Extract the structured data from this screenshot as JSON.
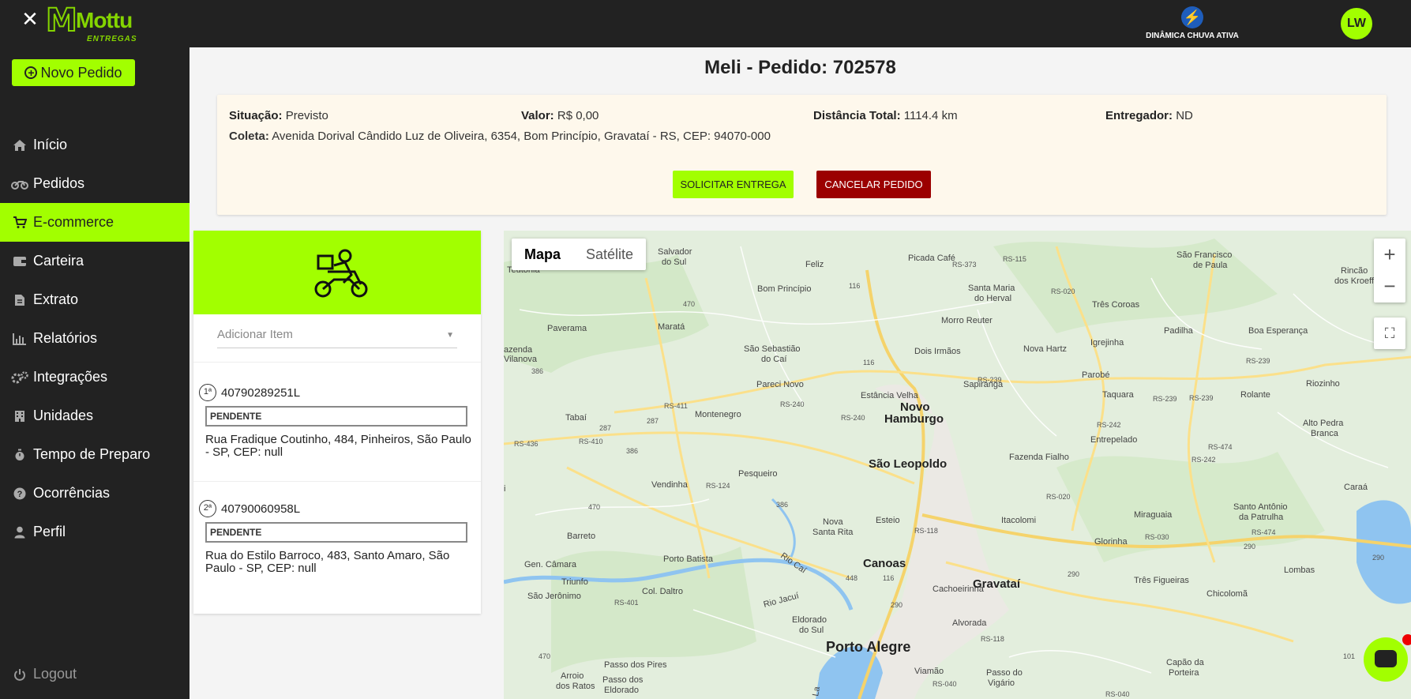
{
  "header": {
    "logo_text": "Mottu",
    "logo_sub": "ENTREGAS",
    "rain_label": "DINÂMICA CHUVA ATIVA",
    "avatar_initials": "LW"
  },
  "sidebar": {
    "new_order_label": "Novo Pedido",
    "items": [
      {
        "label": "Início",
        "icon": "home-icon"
      },
      {
        "label": "Pedidos",
        "icon": "motorcycle-icon"
      },
      {
        "label": "E-commerce",
        "icon": "cart-icon"
      },
      {
        "label": "Carteira",
        "icon": "wallet-icon"
      },
      {
        "label": "Extrato",
        "icon": "document-icon"
      },
      {
        "label": "Relatórios",
        "icon": "bar-chart-icon"
      },
      {
        "label": "Integrações",
        "icon": "gears-icon"
      },
      {
        "label": "Unidades",
        "icon": "building-icon"
      },
      {
        "label": "Tempo de Preparo",
        "icon": "stopwatch-icon"
      },
      {
        "label": "Ocorrências",
        "icon": "question-icon"
      },
      {
        "label": "Perfil",
        "icon": "user-icon"
      }
    ],
    "active_index": 2,
    "logout_label": "Logout"
  },
  "order": {
    "title": "Meli - Pedido: 702578",
    "situacao_label": "Situação:",
    "situacao_value": "Previsto",
    "valor_label": "Valor:",
    "valor_value": "R$ 0,00",
    "distancia_label": "Distância Total:",
    "distancia_value": "1114.4 km",
    "entregador_label": "Entregador:",
    "entregador_value": "ND",
    "coleta_label": "Coleta:",
    "coleta_value": "Avenida Dorival Cândido Luz de Oliveira, 6354, Bom Princípio, Gravataí - RS, CEP: 94070-000",
    "solicitar_label": "SOLICITAR ENTREGA",
    "cancelar_label": "CANCELAR PEDIDO"
  },
  "items_panel": {
    "add_item_placeholder": "Adicionar Item",
    "stops": [
      {
        "num": "1ª",
        "code": "40790289251L",
        "status": "PENDENTE",
        "address": "Rua Fradique Coutinho, 484, Pinheiros, São Paulo - SP, CEP: null"
      },
      {
        "num": "2ª",
        "code": "40790060958L",
        "status": "PENDENTE",
        "address": "Rua do Estilo Barroco, 483, Santo Amaro, São Paulo - SP, CEP: null"
      }
    ]
  },
  "map": {
    "type_map": "Mapa",
    "type_satellite": "Satélite",
    "zoom_in": "+",
    "zoom_out": "−",
    "places": {
      "teutonia": "Teutônia",
      "salvador": "Salvador",
      "do_sul": "do Sul",
      "feliz": "Feliz",
      "picada": "Picada Café",
      "sao_francisco": "São Francisco",
      "de_paula": "de Paula",
      "rincao": "Rincão",
      "dos_kroeff": "dos Kroeff",
      "bom_principio": "Bom Princípio",
      "santa_maria": "Santa Maria",
      "do_herval": "do Herval",
      "tres_coroas": "Três Coroas",
      "paverama": "Paverama",
      "marata": "Maratá",
      "morro_reuter": "Morro Reuter",
      "padilha": "Padilha",
      "boa_esperanca": "Boa Esperança",
      "azenda": "azenda",
      "vilanova": "Vilanova",
      "sao_sebastiao": "São Sebastião",
      "do_cai": "do Caí",
      "dois_irmaos": "Dois Irmãos",
      "nova_hartz": "Nova Hartz",
      "igrejinha": "Igrejinha",
      "pareci": "Pareci Novo",
      "sapiranga": "Sapiranga",
      "parobe": "Parobé",
      "riozinho": "Riozinho",
      "estancia": "Estância Velha",
      "taquara": "Taquara",
      "rolante": "Rolante",
      "tabai": "Tabaí",
      "montenegro": "Montenegro",
      "novo": "Novo",
      "hamburgo": "Hamburgo",
      "alto_pedra": "Alto Pedra",
      "branca": "Branca",
      "entrepelado": "Entrepelado",
      "sao_leopoldo": "São Leopoldo",
      "fazenda_fialho": "Fazenda Fialho",
      "pesqueiro": "Pesqueiro",
      "vendinha": "Vendinha",
      "caraa": "Caraá",
      "santo_antonio": "Santo Antônio",
      "da_patrulha": "da Patrulha",
      "nova": "Nova",
      "santa_rita": "Santa Rita",
      "esteio": "Esteio",
      "itacolomi": "Itacolomi",
      "miraguaia": "Miraguaia",
      "barreto": "Barreto",
      "glorinha": "Glorinha",
      "gen_camara": "Gen. Câmara",
      "porto_batista": "Porto Batista",
      "rio_cai": "Rio Caí",
      "canoas": "Canoas",
      "lombas": "Lombas",
      "triunfo": "Triunfo",
      "tres_figueiras": "Três Figueiras",
      "cachoeirinha": "Cachoeirinha",
      "gravatai": "Gravataí",
      "sao_jeronimo": "São Jerônimo",
      "col_daltro": "Col. Daltro",
      "chicoloma": "Chicolomã",
      "rio_jacui": "Rio Jacuí",
      "eldorado": "Eldorado",
      "do_sul2": "do Sul",
      "alvorada": "Alvorada",
      "porto_alegre": "Porto Alegre",
      "arroio": "Arroio",
      "dos_ratos": "dos Ratos",
      "passo_pires": "Passo dos Pires",
      "capao": "Capão da",
      "porteira": "Porteira",
      "passo": "Passo do",
      "vigario": "Vigário",
      "viamao": "Viamão",
      "passo_dos": "Passo dos",
      "eldorado2": "Eldorado",
      "i": "i",
      "la": "La"
    },
    "shields": {
      "rs373": "RS-373",
      "rs115": "RS-115",
      "rs020": "RS-020",
      "r116a": "116",
      "r470a": "470",
      "r116b": "116",
      "rs239a": "RS-239",
      "rs239b": "RS-239",
      "rs239c": "RS-239",
      "rs239d": "RS-239",
      "r386a": "386",
      "rs411": "RS-411",
      "rs240a": "RS-240",
      "rs240b": "RS-240",
      "r287a": "287",
      "r287b": "287",
      "rs436": "RS-436",
      "rs410": "RS-410",
      "r386b": "386",
      "rs242a": "RS-242",
      "rs474a": "RS-474",
      "rs242b": "RS-242",
      "rs124": "RS-124",
      "r386c": "386",
      "rs020b": "RS-020",
      "r470b": "470",
      "rs118a": "RS-118",
      "rs030": "RS-030",
      "r290a": "290",
      "rs474b": "RS-474",
      "r290b": "290",
      "r448": "448",
      "r116c": "116",
      "r290c": "290",
      "r290d": "290",
      "rs401": "RS-401",
      "rs118b": "RS-118",
      "r470c": "470",
      "rs040a": "RS-040",
      "r101": "101",
      "rs040b": "RS-040"
    }
  },
  "colors": {
    "accent": "#a2ff00",
    "dark": "#222222",
    "danger": "#9b0000",
    "card": "#fef8ec"
  }
}
